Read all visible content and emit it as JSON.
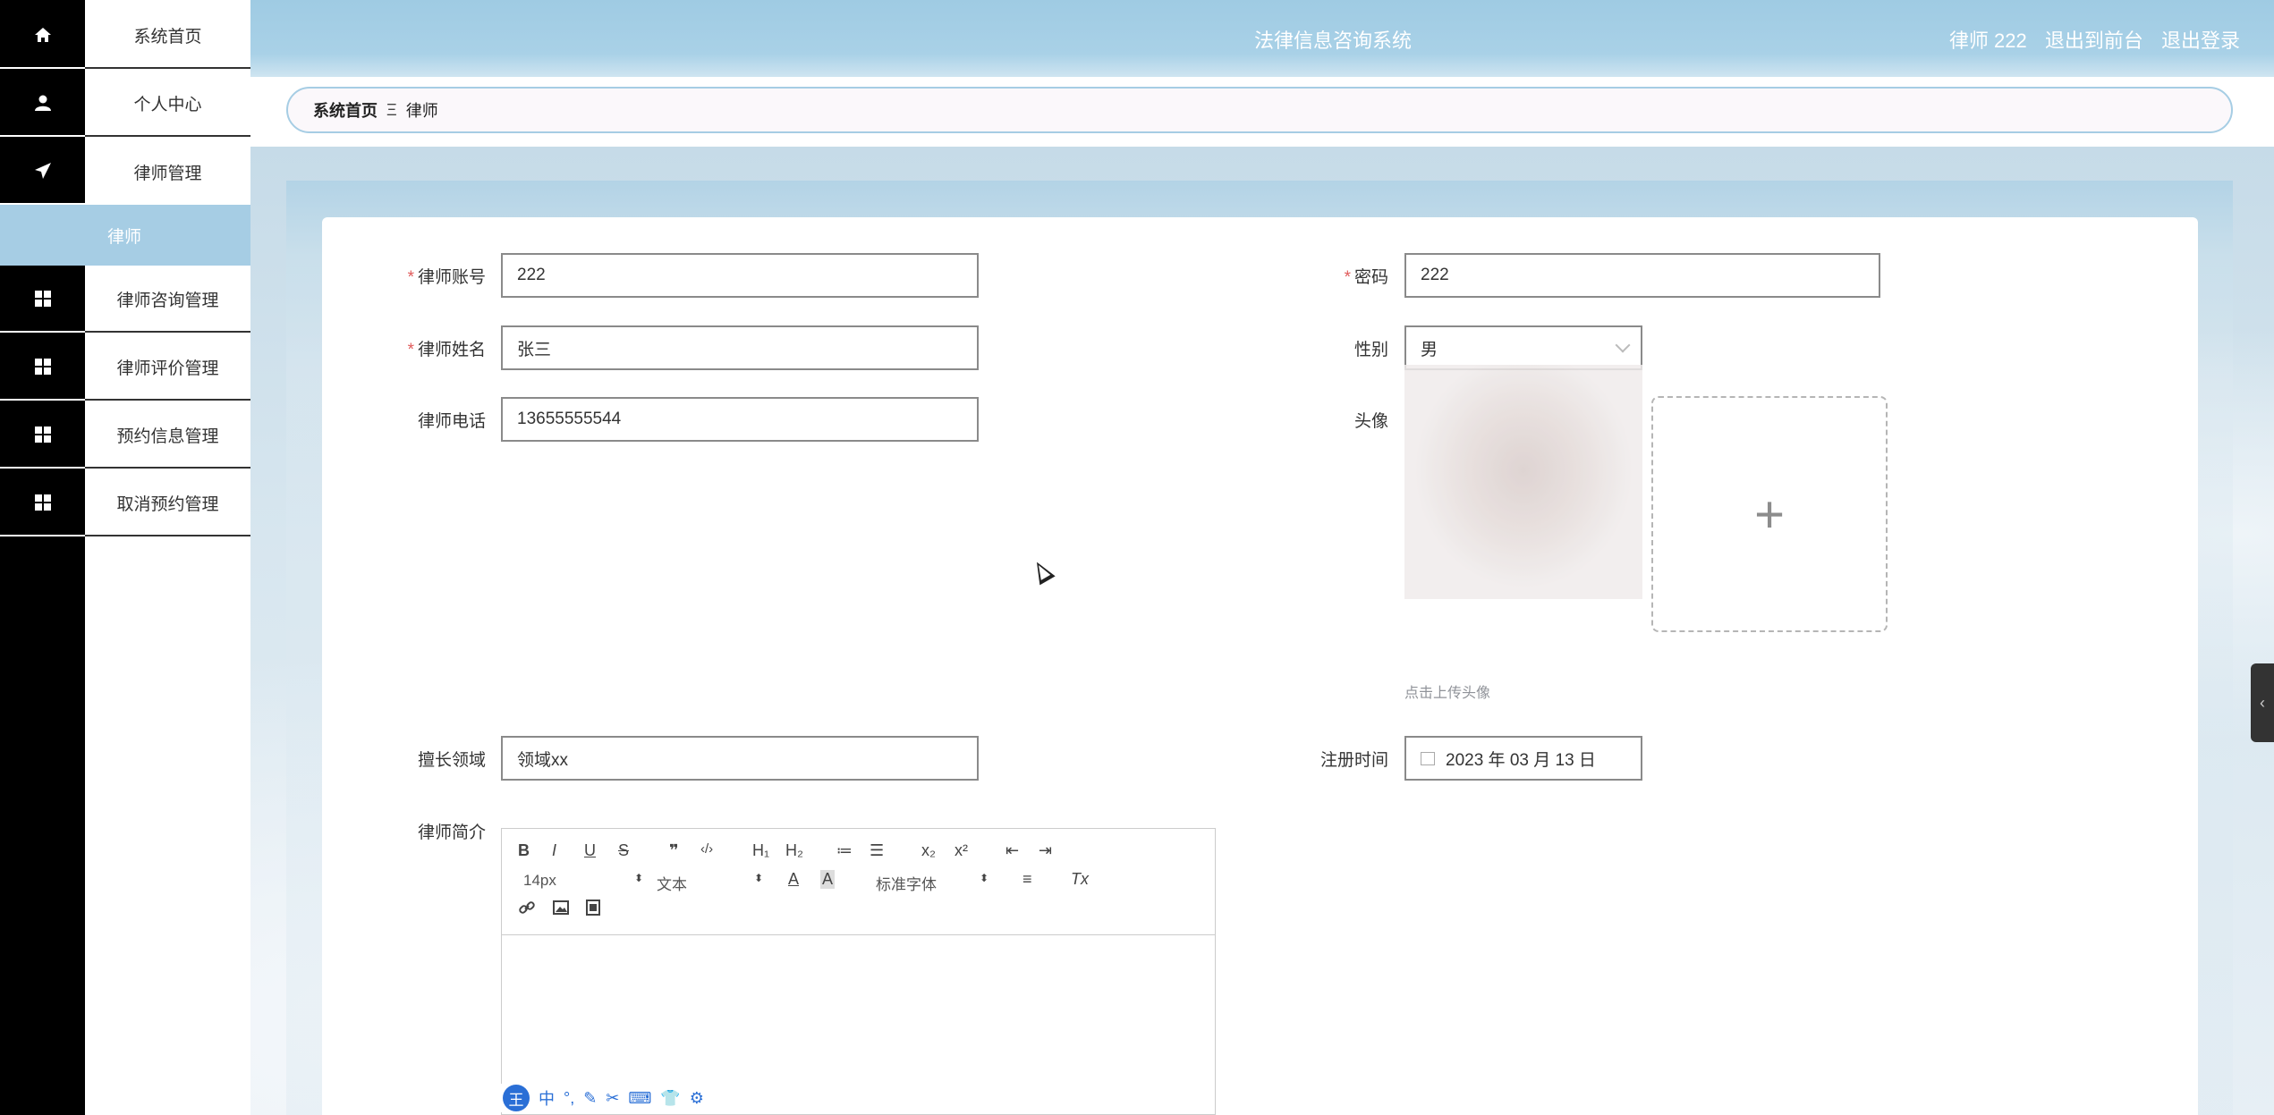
{
  "header": {
    "title": "法律信息咨询系统",
    "user": "律师 222",
    "to_front": "退出到前台",
    "logout": "退出登录"
  },
  "breadcrumb": {
    "home": "系统首页",
    "separator": "Ξ",
    "current": "律师"
  },
  "sidebar": {
    "items": [
      {
        "label": "系统首页",
        "icon": "home-icon"
      },
      {
        "label": "个人中心",
        "icon": "user-icon"
      },
      {
        "label": "律师管理",
        "icon": "paper-plane-icon"
      },
      {
        "label": "律师咨询管理",
        "icon": "grid-icon"
      },
      {
        "label": "律师评价管理",
        "icon": "grid-icon"
      },
      {
        "label": "预约信息管理",
        "icon": "grid-icon"
      },
      {
        "label": "取消预约管理",
        "icon": "grid-icon"
      }
    ],
    "active_sub": "律师"
  },
  "form": {
    "account": {
      "label": "律师账号",
      "value": "222",
      "required": true
    },
    "password": {
      "label": "密码",
      "value": "222",
      "required": true
    },
    "name": {
      "label": "律师姓名",
      "value": "张三",
      "required": true
    },
    "gender": {
      "label": "性别",
      "value": "男"
    },
    "phone": {
      "label": "律师电话",
      "value": "13655555544"
    },
    "avatar": {
      "label": "头像",
      "hint": "点击上传头像",
      "upload_symbol": "+"
    },
    "field": {
      "label": "擅长领域",
      "value": "领域xx"
    },
    "register_time": {
      "label": "注册时间",
      "value": "2023 年 03 月 13 日"
    },
    "intro": {
      "label": "律师简介"
    }
  },
  "editor": {
    "row1": [
      "B",
      "I",
      "U",
      "S",
      "❞",
      "‹/›",
      "H₁",
      "H₂",
      "≔",
      "☰",
      "x₂",
      "x²",
      "⇤",
      "⇥"
    ],
    "font_size": "14px",
    "block_type": "文本",
    "font_family": "标准字体",
    "color_icon": "A",
    "bg_icon": "A",
    "align_icon": "≡",
    "clear_icon": "Tx"
  },
  "ime_bar": [
    "王",
    "中",
    "°,",
    "✎",
    "✂",
    "⌨",
    "👕",
    "⚙"
  ],
  "colors": {
    "accent": "#a6cde4",
    "sidebar_dark": "#000000",
    "required": "#e05b5b"
  }
}
